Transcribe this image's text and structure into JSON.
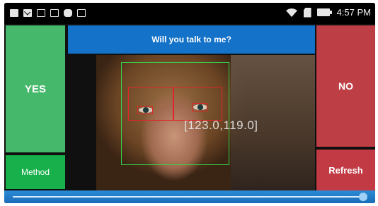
{
  "status_bar": {
    "time": "4:57 PM",
    "left_icons": [
      "window-icon",
      "mail-icon",
      "folder-icon",
      "envelope-icon",
      "gamepad-icon",
      "bag-icon"
    ],
    "right_icons": [
      "wifi-icon",
      "sd-card-icon",
      "battery-icon"
    ]
  },
  "app": {
    "title": "Will you talk to me?",
    "yes_label": "YES",
    "method_label": "Method",
    "no_label": "NO",
    "refresh_label": "Refresh",
    "coordinates": "[123.0,119.0]"
  },
  "colors": {
    "yes": "#46b86b",
    "method": "#17b04a",
    "title_bar": "#1472c8",
    "no": "#bd3e44",
    "refresh": "#c23b44",
    "face_box": "#35d44a",
    "eye_box": "#e0242a"
  }
}
